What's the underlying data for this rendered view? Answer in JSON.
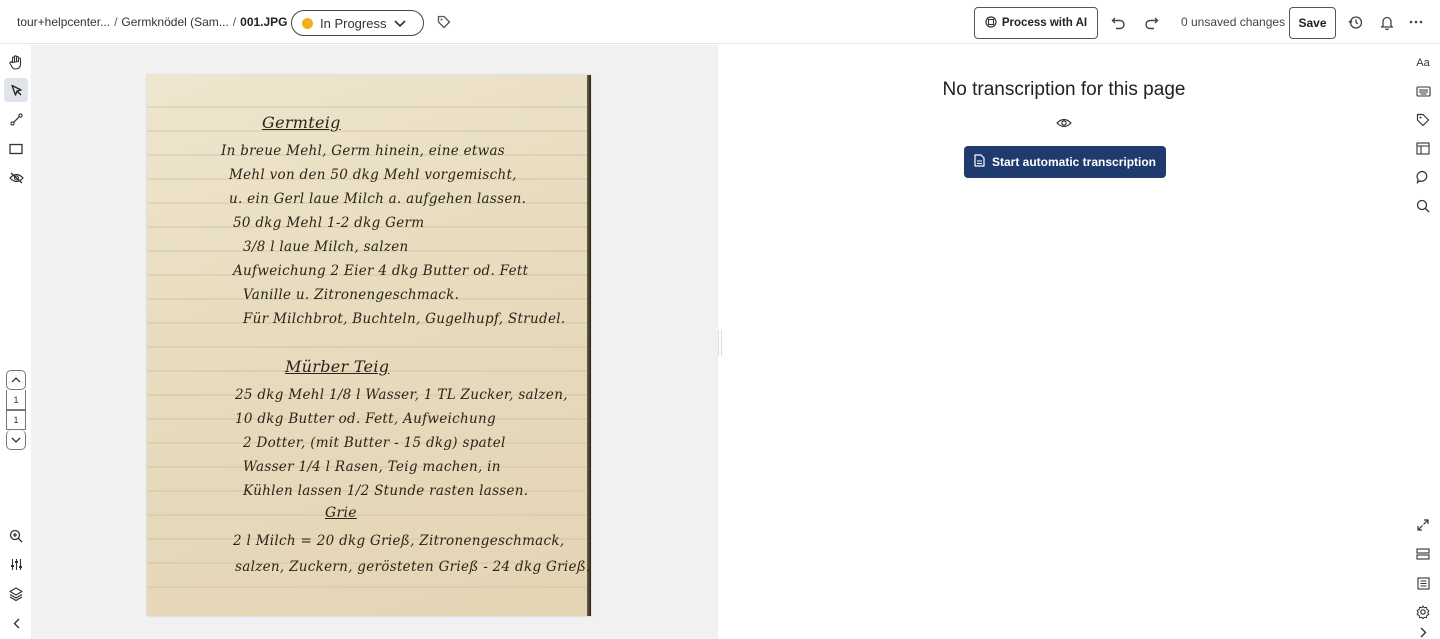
{
  "header": {
    "breadcrumb": [
      {
        "label": "tour+helpcenter..."
      },
      {
        "label": "Germknödel (Sam..."
      },
      {
        "label": "001.JPG"
      }
    ],
    "breadcrumb_sep": "/",
    "status": {
      "label": "In Progress",
      "dot_color": "#f2b01e"
    },
    "process_ai_label": "Process with AI",
    "unsaved_label": "0 unsaved changes",
    "save_label": "Save"
  },
  "left_toolbar": {
    "tools": [
      "hand-icon",
      "pointer-icon",
      "line-icon",
      "rectangle-icon",
      "eye-off-icon"
    ],
    "active_tool": "pointer-icon",
    "pager": {
      "current": "1",
      "total": "1"
    },
    "bottom_tools": [
      "zoom-in-icon",
      "sliders-icon",
      "layers-icon",
      "chevron-left-icon"
    ]
  },
  "document": {
    "title_line": "Germteig",
    "lines": [
      "In breue Mehl, Germ hinein, eine etwas",
      "Mehl von den 50 dkg Mehl vorgemischt,",
      "u. ein Gerl laue Milch a. aufgehen lassen.",
      "50 dkg Mehl 1-2 dkg Germ",
      "3/8 l laue Milch, salzen",
      "Aufweichung 2 Eier 4 dkg Butter od. Fett",
      "Vanille u. Zitronengeschmack.",
      "Für Milchbrot, Buchteln, Gugelhupf, Strudel."
    ],
    "subtitle_line": "Mürber Teig",
    "lines2": [
      "25 dkg Mehl 1/8 l Wasser, 1 TL Zucker, salzen,",
      "10 dkg Butter od. Fett, Aufweichung",
      "2 Dotter, (mit Butter - 15 dkg) spatel",
      "Wasser 1/4 l Rasen, Teig machen, in",
      "Kühlen lassen 1/2 Stunde rasten lassen."
    ],
    "underline_word": "Grie",
    "lines3": [
      "2 l Milch = 20 dkg Grieß, Zitronengeschmack,",
      "salzen, Zuckern, gerösteten Grieß - 24 dkg Grieß."
    ]
  },
  "transcription": {
    "empty_message": "No transcription for this page",
    "start_label": "Start automatic transcription"
  },
  "right_toolbar": {
    "top": [
      "text-size-icon",
      "keyboard-icon",
      "tag-icon",
      "layout-icon",
      "comment-icon",
      "search-icon"
    ],
    "font_label": "Aa",
    "bottom": [
      "expand-icon",
      "list-icon",
      "document-icon",
      "settings-icon",
      "chevron-right-icon"
    ]
  },
  "colors": {
    "accent": "#1f3a6d",
    "status": "#f2b01e"
  }
}
